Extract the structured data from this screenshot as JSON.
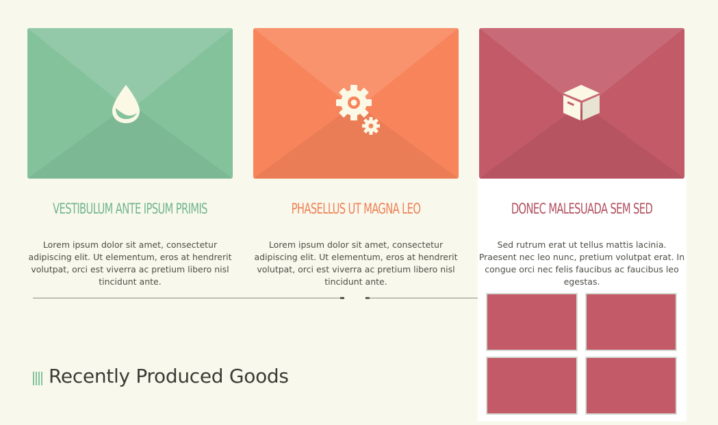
{
  "features": [
    {
      "title": "Vestibulum ante ipsum primis",
      "text": "Lorem ipsum dolor sit amet, consectetur adipiscing elit. Ut elementum, eros at hendrerit volutpat, orci est viverra ac pretium libero nisl tincidunt ante.",
      "icon": "water-drop-icon",
      "color": "#84c29c",
      "title_color": "#72b48e"
    },
    {
      "title": "Phasellus ut magna leo",
      "text": "Lorem ipsum dolor sit amet, consectetur adipiscing elit. Ut elementum, eros at hendrerit volutpat, orci est viverra ac pretium libero nisl tincidunt ante.",
      "icon": "gears-icon",
      "color": "#f7845b",
      "title_color": "#ef7f56"
    },
    {
      "title": "Donec malesuada sem sed",
      "text": "Sed rutrum erat ut tellus mattis lacinia. Praesent nec leo nunc, pretium volutpat erat. In congue orci nec felis faucibus ac faucibus leo egestas.",
      "icon": "box-icon",
      "color": "#c25a68",
      "title_color": "#b14f5d"
    }
  ],
  "gallery_thumbnails": 4,
  "section": {
    "title": "Recently Produced Goods",
    "icon": "bars-icon",
    "accent": "#84c29c"
  },
  "colors": {
    "background": "#f8f9ec",
    "text": "#4d4d46"
  }
}
